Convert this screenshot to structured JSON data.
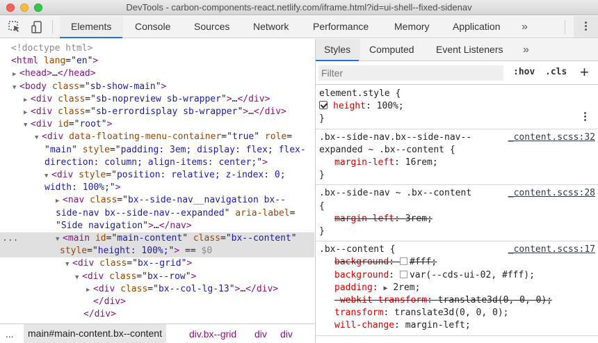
{
  "window": {
    "title": "DevTools - carbon-components-react.netlify.com/iframe.html?id=ui-shell--fixed-sidenav"
  },
  "toolbar": {
    "tabs": [
      "Elements",
      "Console",
      "Sources",
      "Network",
      "Performance",
      "Memory",
      "Application"
    ],
    "more_symbol": "»"
  },
  "elements": {
    "lines": [
      {
        "segs": [
          [
            "cm",
            "<!doctype html>"
          ]
        ]
      },
      {
        "segs": [
          [
            "tag",
            "<html"
          ],
          [
            "sp",
            " "
          ],
          [
            "attr",
            "lang"
          ],
          [
            "eq",
            "=\""
          ],
          [
            "val",
            "en"
          ],
          [
            "eq",
            "\""
          ],
          [
            "tag",
            ">"
          ]
        ]
      },
      {
        "tri": "▶",
        "segs": [
          [
            "tag",
            "<head>"
          ],
          [
            "txt",
            "…"
          ],
          [
            "tag",
            "</head>"
          ]
        ]
      },
      {
        "tri": "▼",
        "segs": [
          [
            "tag",
            "<body"
          ],
          [
            "sp",
            " "
          ],
          [
            "attr",
            "class"
          ],
          [
            "eq",
            "=\""
          ],
          [
            "val",
            "sb-show-main"
          ],
          [
            "eq",
            "\""
          ],
          [
            "tag",
            ">"
          ]
        ]
      },
      {
        "tri": "▶",
        "segs": [
          [
            "tag",
            "<div"
          ],
          [
            "sp",
            " "
          ],
          [
            "attr",
            "class"
          ],
          [
            "eq",
            "=\""
          ],
          [
            "val",
            "sb-nopreview sb-wrapper"
          ],
          [
            "eq",
            "\""
          ],
          [
            "tag",
            ">"
          ],
          [
            "txt",
            "…"
          ],
          [
            "tag",
            "</div>"
          ]
        ]
      },
      {
        "tri": "▶",
        "segs": [
          [
            "tag",
            "<div"
          ],
          [
            "sp",
            " "
          ],
          [
            "attr",
            "class"
          ],
          [
            "eq",
            "=\""
          ],
          [
            "val",
            "sb-errordisplay sb-wrapper"
          ],
          [
            "eq",
            "\""
          ],
          [
            "tag",
            ">"
          ],
          [
            "txt",
            "…"
          ],
          [
            "tag",
            "</div>"
          ]
        ]
      },
      {
        "tri": "▼",
        "segs": [
          [
            "tag",
            "<div"
          ],
          [
            "sp",
            " "
          ],
          [
            "attr",
            "id"
          ],
          [
            "eq",
            "=\""
          ],
          [
            "val",
            "root"
          ],
          [
            "eq",
            "\""
          ],
          [
            "tag",
            ">"
          ]
        ]
      },
      {
        "tri": "▼",
        "segs": [
          [
            "tag",
            "<div"
          ],
          [
            "sp",
            " "
          ],
          [
            "attr",
            "data-floating-menu-container"
          ],
          [
            "eq",
            "=\""
          ],
          [
            "val",
            "true"
          ],
          [
            "eq",
            "\""
          ],
          [
            "sp",
            " "
          ],
          [
            "attr",
            "role"
          ],
          [
            "eq",
            "="
          ]
        ]
      },
      {
        "segs": [
          [
            "eq",
            "\""
          ],
          [
            "val",
            "main"
          ],
          [
            "eq",
            "\""
          ],
          [
            "sp",
            " "
          ],
          [
            "attr",
            "style"
          ],
          [
            "eq",
            "=\""
          ],
          [
            "val",
            "padding: 3em; display: flex; flex-"
          ]
        ]
      },
      {
        "segs": [
          [
            "val",
            "direction: column; align-items: center;"
          ],
          [
            "eq",
            "\""
          ],
          [
            "tag",
            ">"
          ]
        ]
      },
      {
        "tri": "▼",
        "segs": [
          [
            "tag",
            "<div"
          ],
          [
            "sp",
            " "
          ],
          [
            "attr",
            "style"
          ],
          [
            "eq",
            "=\""
          ],
          [
            "val",
            "position: relative; z-index: 0;"
          ]
        ]
      },
      {
        "segs": [
          [
            "val",
            "width: 100%;"
          ],
          [
            "eq",
            "\""
          ],
          [
            "tag",
            ">"
          ]
        ]
      },
      {
        "tri": "▶",
        "segs": [
          [
            "tag",
            "<nav"
          ],
          [
            "sp",
            " "
          ],
          [
            "attr",
            "class"
          ],
          [
            "eq",
            "=\""
          ],
          [
            "val",
            "bx--side-nav__navigation bx--"
          ]
        ]
      },
      {
        "segs": [
          [
            "val",
            "side-nav bx--side-nav--expanded"
          ],
          [
            "eq",
            "\""
          ],
          [
            "sp",
            " "
          ],
          [
            "attr",
            "aria-label"
          ],
          [
            "eq",
            "="
          ]
        ]
      },
      {
        "segs": [
          [
            "eq",
            "\""
          ],
          [
            "val",
            "Side navigation"
          ],
          [
            "eq",
            "\""
          ],
          [
            "tag",
            ">"
          ],
          [
            "txt",
            "…"
          ],
          [
            "tag",
            "</nav>"
          ]
        ]
      },
      {
        "tri": "▼",
        "segs": [
          [
            "tag",
            "<main"
          ],
          [
            "sp",
            " "
          ],
          [
            "attr",
            "id"
          ],
          [
            "eq",
            "=\""
          ],
          [
            "val",
            "main-content"
          ],
          [
            "eq",
            "\""
          ],
          [
            "sp",
            " "
          ],
          [
            "attr",
            "class"
          ],
          [
            "eq",
            "=\""
          ],
          [
            "val",
            "bx--content"
          ],
          [
            "eq",
            "\""
          ]
        ]
      },
      {
        "segs": [
          [
            "attr",
            "style"
          ],
          [
            "eq",
            "=\""
          ],
          [
            "val",
            "height: 100%;"
          ],
          [
            "eq",
            "\""
          ],
          [
            "tag",
            ">"
          ],
          [
            "txt",
            " == "
          ],
          [
            "dim",
            "$0"
          ]
        ]
      },
      {
        "tri": "▼",
        "segs": [
          [
            "tag",
            "<div"
          ],
          [
            "sp",
            " "
          ],
          [
            "attr",
            "class"
          ],
          [
            "eq",
            "=\""
          ],
          [
            "val",
            "bx--grid"
          ],
          [
            "eq",
            "\""
          ],
          [
            "tag",
            ">"
          ]
        ]
      },
      {
        "tri": "▼",
        "segs": [
          [
            "tag",
            "<div"
          ],
          [
            "sp",
            " "
          ],
          [
            "attr",
            "class"
          ],
          [
            "eq",
            "=\""
          ],
          [
            "val",
            "bx--row"
          ],
          [
            "eq",
            "\""
          ],
          [
            "tag",
            ">"
          ]
        ]
      },
      {
        "tri": "▶",
        "segs": [
          [
            "tag",
            "<div"
          ],
          [
            "sp",
            " "
          ],
          [
            "attr",
            "class"
          ],
          [
            "eq",
            "=\""
          ],
          [
            "val",
            "bx--col-lg-13"
          ],
          [
            "eq",
            "\""
          ],
          [
            "tag",
            ">"
          ],
          [
            "txt",
            "…"
          ],
          [
            "tag",
            "</div>"
          ]
        ]
      },
      {
        "segs": [
          [
            "tag",
            "</div>"
          ]
        ]
      },
      {
        "segs": [
          [
            "tag",
            "</div>"
          ]
        ]
      }
    ],
    "selected_marker": "..."
  },
  "breadcrumb": {
    "more": "...",
    "items": [
      "main#main-content.bx--content",
      "div.bx--grid",
      "div",
      "div"
    ]
  },
  "styles": {
    "tabs": [
      "Styles",
      "Computed",
      "Event Listeners"
    ],
    "more_symbol": "»",
    "filter_placeholder": "Filter",
    "hov": ":hov",
    "cls": ".cls",
    "add": "+",
    "rules": [
      {
        "selector": [
          "element.style {"
        ],
        "source": "",
        "decls": [
          {
            "name": "height",
            "value": "100%;",
            "checkbox": true
          }
        ],
        "close": "}"
      },
      {
        "selector": [
          ".bx--side-nav.bx--side-nav--",
          "expanded ~ .bx--content {"
        ],
        "source": "_content.scss:32",
        "decls": [
          {
            "name": "margin-left",
            "value": "16rem;"
          }
        ],
        "close": "}"
      },
      {
        "selector": [
          ".bx--side-nav ~ .bx--content",
          "{"
        ],
        "source": "_content.scss:28",
        "decls": [
          {
            "name": "margin-left",
            "value": "3rem;",
            "struck": true
          }
        ],
        "close": "}"
      },
      {
        "selector": [
          ".bx--content {"
        ],
        "source": "_content.scss:17",
        "decls": [
          {
            "name": "background",
            "value": "#fff;",
            "struck": true,
            "swatch": "#ffffff"
          },
          {
            "name": "background",
            "value": "var(--cds-ui-02, #fff);",
            "swatch": "#ffffff"
          },
          {
            "name": "padding",
            "value": "2rem;",
            "arrow": "▶"
          },
          {
            "name": "-webkit-transform",
            "value": "translate3d(0, 0, 0);",
            "struck": true
          },
          {
            "name": "transform",
            "value": "translate3d(0, 0, 0);"
          },
          {
            "name": "will-change",
            "value": "margin-left;"
          }
        ],
        "close": ""
      }
    ]
  },
  "colors": {
    "accent": "#1a73e8",
    "tag": "#881280",
    "attr": "#994500",
    "value": "#1a1aa6",
    "property": "#c80000"
  }
}
